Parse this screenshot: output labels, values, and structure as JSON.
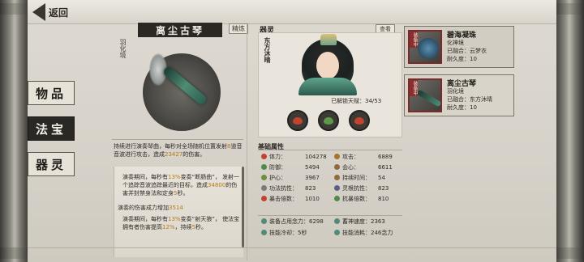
{
  "header": {
    "back_label": "返回"
  },
  "nav": {
    "items": [
      {
        "label": "物品",
        "active": false
      },
      {
        "label": "法宝",
        "active": true
      },
      {
        "label": "器灵",
        "active": false
      }
    ]
  },
  "item": {
    "name": "离尘古琴",
    "grade": "精炼",
    "realm": "羽化境",
    "desc_prefix": "持续进行演奏琴曲，每秒对全场随机位置发射",
    "desc_count": "8",
    "desc_mid": "道音音波进行攻击，造成",
    "desc_damage": "23427",
    "desc_suffix": "的伤害。",
    "skills": [
      {
        "p1": "演奏期间，每秒有",
        "chance": "13%",
        "p2": "变奏“断肠曲”，",
        "p3": "发射一个追踪音波追踪最近的目标，造成",
        "dmg": "34800",
        "p4": "的伤害并封禁身法和定身",
        "sec": "5",
        "p5": "秒。"
      },
      {
        "p1": "演奏的伤害成力增加",
        "value": "3514"
      },
      {
        "p1": "演奏期间，每秒有",
        "chance": "13%",
        "p2": "变奏“射天狼”，",
        "p3": "使法宝拥有者伤害提高",
        "pct": "12%",
        "p4": "，持续",
        "sec": "5",
        "p5": "秒。"
      }
    ]
  },
  "spirit": {
    "label": "器灵",
    "view_label": "查看",
    "name": "东方沐晴",
    "awaken_label": "已解锁天赋：",
    "awaken_value": "34/53",
    "talents": [
      {
        "icon": "red-leaf-icon",
        "color": "#c4432f"
      },
      {
        "icon": "green-leaf-icon",
        "color": "#5c9a4a"
      },
      {
        "icon": "red-leaf-icon",
        "color": "#c4432f"
      }
    ]
  },
  "attributes": {
    "title": "基础属性",
    "left": [
      {
        "label": "体力：",
        "value": "104278",
        "color": "#c4432f"
      },
      {
        "label": "防御：",
        "value": "5494",
        "color": "#4f8a4a"
      },
      {
        "label": "护心：",
        "value": "3967",
        "color": "#6b8f3a"
      },
      {
        "label": "功法抗性：",
        "value": "823",
        "color": "#7a7a7a"
      },
      {
        "label": "暴击倍数：",
        "value": "1010",
        "color": "#c4432f"
      }
    ],
    "right": [
      {
        "label": "攻击：",
        "value": "6889",
        "color": "#a5732a"
      },
      {
        "label": "会心：",
        "value": "6611",
        "color": "#8f6a3a"
      },
      {
        "label": "持续时间：",
        "value": "54",
        "color": "#8f6a3a"
      },
      {
        "label": "灵根抗性：",
        "value": "823",
        "color": "#5d5d8a"
      },
      {
        "label": "抗暴倍数：",
        "value": "810",
        "color": "#4f8a4a"
      }
    ],
    "extra": [
      {
        "label": "装备占用念力：",
        "value": "6298",
        "color": "#4f8a7a"
      },
      {
        "label": "蓄神速度：",
        "value": "2363",
        "color": "#4f8a7a"
      },
      {
        "label": "技能冷却：",
        "value": "5秒",
        "color": "#4f8a7a"
      },
      {
        "label": "技能消耗：",
        "value": "246念力",
        "color": "#4f8a7a"
      }
    ]
  },
  "equipment": [
    {
      "flag": "装备中",
      "name": "碧海凝珠",
      "realm": "化神境",
      "fused": "已融合：云梦衣",
      "durability": "耐久度：10",
      "thumb": "blue-pearl-icon"
    },
    {
      "flag": "装备中",
      "name": "离尘古琴",
      "realm": "羽化境",
      "fused": "已融合：东方沐晴",
      "durability": "耐久度：10",
      "thumb": "guqin-icon"
    }
  ]
}
